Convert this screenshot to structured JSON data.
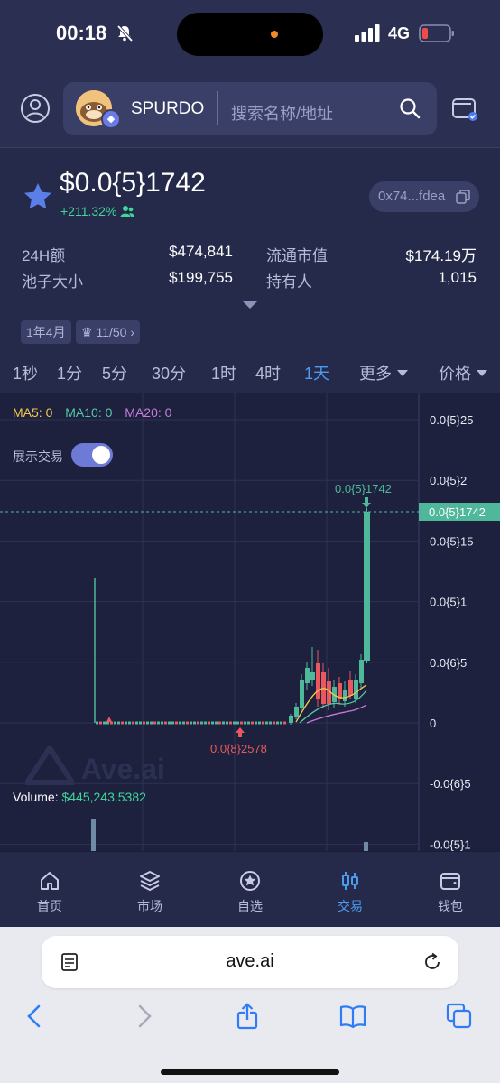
{
  "status_bar": {
    "time": "00:18",
    "network": "4G"
  },
  "header": {
    "token_name": "SPURDO",
    "search_placeholder": "搜索名称/地址"
  },
  "price": {
    "value": "$0.0{5}1742",
    "change": "+211.32%",
    "address": "0x74...fdea"
  },
  "stats": {
    "vol_label": "24H额",
    "vol_value": "$474,841",
    "mcap_label": "流通市值",
    "mcap_value": "$174.19万",
    "pool_label": "池子大小",
    "pool_value": "$199,755",
    "holders_label": "持有人",
    "holders_value": "1,015"
  },
  "tags": {
    "age": "1年4月",
    "rank": "11/50"
  },
  "timeframes": [
    "1秒",
    "1分",
    "5分",
    "30分",
    "1时",
    "4时",
    "1天"
  ],
  "active_timeframe": "1天",
  "more_label": "更多",
  "price_label": "价格",
  "chart": {
    "ma5": "MA5: 0",
    "ma10": "MA10: 0",
    "ma20": "MA20: 0",
    "show_trades_label": "展示交易",
    "show_trades": true,
    "watermark": "Ave.ai",
    "volume_label": "Volume:",
    "volume_value": "$445,243.5382",
    "high_label": "0.0{5}1742",
    "low_label": "0.0{8}2578",
    "current_price_label": "0.0{5}1742",
    "ma_colors": {
      "ma5": "#f2c94c",
      "ma10": "#55c9a6",
      "ma20": "#c77ddb"
    },
    "up_color": "#4fb89a",
    "down_color": "#e8585e"
  },
  "chart_data": {
    "type": "candlestick",
    "y_ticks": [
      "0.0{5}25",
      "0.0{5}2",
      "0.0{5}15",
      "0.0{5}1",
      "0.0{6}5",
      "0",
      "-0.0{6}5",
      "-0.0{5}1"
    ],
    "ylim": [
      -1e-05,
      2.5e-05
    ],
    "grid": true
  },
  "tabbar": [
    {
      "label": "首页",
      "icon": "home-icon"
    },
    {
      "label": "市场",
      "icon": "layers-icon"
    },
    {
      "label": "自选",
      "icon": "star-circle-icon"
    },
    {
      "label": "交易",
      "icon": "candles-icon"
    },
    {
      "label": "钱包",
      "icon": "wallet-icon"
    }
  ],
  "safari": {
    "url": "ave.ai"
  }
}
